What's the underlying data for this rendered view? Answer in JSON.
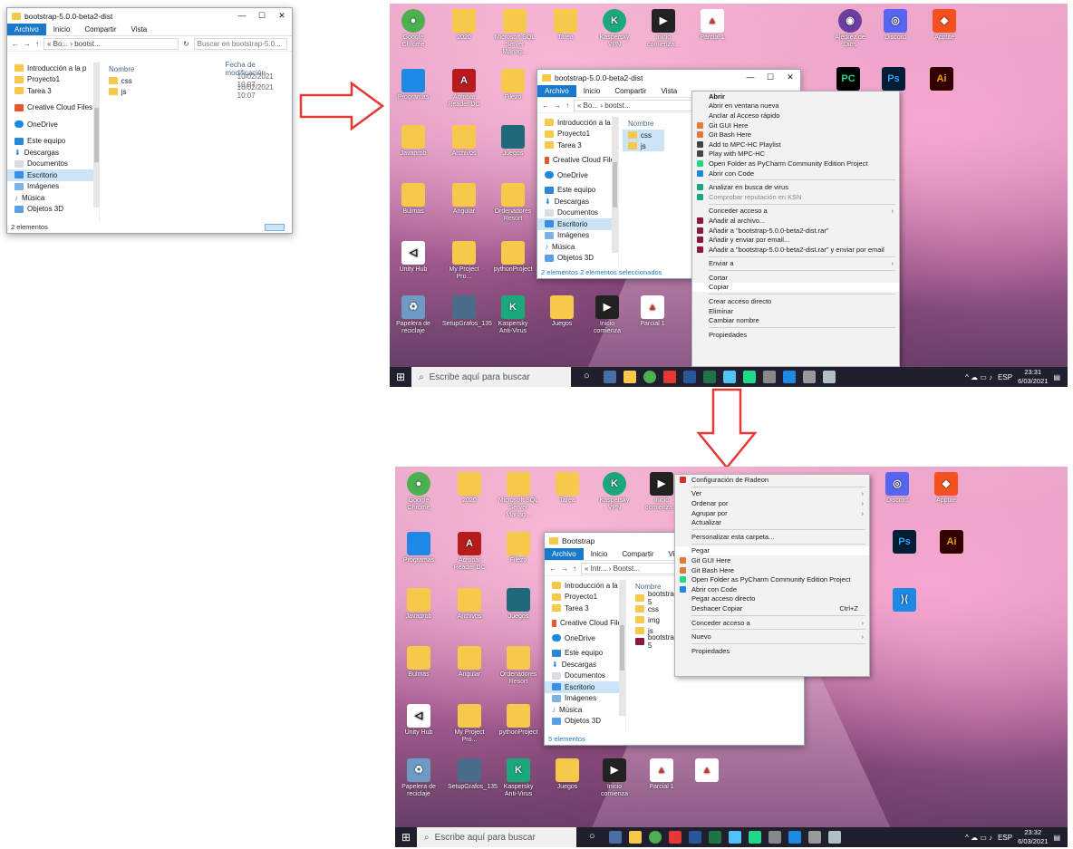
{
  "colors": {
    "accent": "#1979ca",
    "selection": "#cce4f7",
    "folder": "#f6c94a",
    "arrow": "#e53935",
    "taskbar": "#1f1f2e"
  },
  "small_window": {
    "title": "bootstrap-5.0.0-beta2-dist",
    "ribbon_tabs": [
      "Archivo",
      "Inicio",
      "Compartir",
      "Vista"
    ],
    "address": "« Bo... › bootst...",
    "search_placeholder": "Buscar en bootstrap-5.0...",
    "nav_items": [
      "Introducción a la p",
      "Proyecto1",
      "Tarea 3",
      "Creative Cloud Files",
      "OneDrive",
      "Este equipo",
      "Descargas",
      "Documentos",
      "Escritorio",
      "Imágenes",
      "Música",
      "Objetos 3D"
    ],
    "selected_nav": "Escritorio",
    "col_name": "Nombre",
    "col_date": "Fecha de modificación",
    "files": [
      {
        "name": "css",
        "date": "10/02/2021 10:07"
      },
      {
        "name": "js",
        "date": "10/02/2021 10:07"
      }
    ],
    "status": "2 elementos"
  },
  "desktop_icons_top": [
    "Google Chrome",
    "2020",
    "Microsoft SQL Server Manag...",
    "Tarea",
    "Kaspersky VPN",
    "Inicio comienza...",
    "Parcial 1",
    "Ajedrez de Dios",
    "Discord",
    "Apptite"
  ],
  "desktop_icons_left": [
    "Programas",
    "Acrobat Reader DC",
    "Filezo",
    "Javaprob",
    "Archivos",
    "Juegos",
    "Bulmas",
    "Angular",
    "Ordenadores Resort",
    "Unity Hub",
    "My Project Pro...",
    "pythonProject",
    "Papelera de reciclaje",
    "SetupGrafos_135",
    "Kaspersky Anti-Virus",
    "Juegos",
    "Inicio comienza",
    "Parcial 1"
  ],
  "window1": {
    "title": "bootstrap-5.0.0-beta2-dist",
    "ribbon_tabs": [
      "Archivo",
      "Inicio",
      "Compartir",
      "Vista"
    ],
    "address": "« Bo... › bootst...",
    "nav_items": [
      "Introducción a la p",
      "Proyecto1",
      "Tarea 3",
      "Creative Cloud Files",
      "OneDrive",
      "Este equipo",
      "Descargas",
      "Documentos",
      "Escritorio",
      "Imágenes",
      "Música",
      "Objetos 3D"
    ],
    "selected_nav": "Escritorio",
    "col_name": "Nombre",
    "files": [
      "css",
      "js"
    ],
    "status": "2 elementos    2 elementos seleccionados"
  },
  "context_menu1": [
    {
      "label": "Abrir",
      "bold": true
    },
    {
      "label": "Abrir en ventana nueva"
    },
    {
      "label": "Anclar al Acceso rápido"
    },
    {
      "label": "Git GUI Here",
      "icon": "#e07b39"
    },
    {
      "label": "Git Bash Here",
      "icon": "#e07b39"
    },
    {
      "label": "Add to MPC-HC Playlist",
      "icon": "#444"
    },
    {
      "label": "Play with MPC-HC",
      "icon": "#444"
    },
    {
      "label": "Open Folder as PyCharm Community Edition Project",
      "icon": "#21d789"
    },
    {
      "label": "Abrir con Code",
      "icon": "#1e88e5"
    },
    {
      "sep": true
    },
    {
      "label": "Analizar en busca de virus",
      "icon": "#1ba87c"
    },
    {
      "label": "Comprobar reputación en KSN",
      "icon": "#1ba87c",
      "disabled": true
    },
    {
      "sep": true
    },
    {
      "label": "Conceder acceso a",
      "submenu": true
    },
    {
      "label": "Añadir al archivo...",
      "icon": "#8b1a3a"
    },
    {
      "label": "Añadir a \"bootstrap-5.0.0-beta2-dist.rar\"",
      "icon": "#8b1a3a"
    },
    {
      "label": "Añadir y enviar por email...",
      "icon": "#8b1a3a"
    },
    {
      "label": "Añadir a \"bootstrap-5.0.0-beta2-dist.rar\" y enviar por email",
      "icon": "#8b1a3a"
    },
    {
      "sep": true
    },
    {
      "label": "Enviar a",
      "submenu": true
    },
    {
      "sep": true
    },
    {
      "label": "Cortar"
    },
    {
      "label": "Copiar",
      "highlight": true
    },
    {
      "sep": true
    },
    {
      "label": "Crear acceso directo"
    },
    {
      "label": "Eliminar"
    },
    {
      "label": "Cambiar nombre"
    },
    {
      "sep": true
    },
    {
      "label": "Propiedades"
    }
  ],
  "taskbar1": {
    "search": "Escribe aquí para buscar",
    "time": "23:31",
    "date": "6/03/2021",
    "lang": "ESP"
  },
  "window2": {
    "title": "Bootstrap",
    "ribbon_tabs": [
      "Archivo",
      "Inicio",
      "Compartir",
      "Vista"
    ],
    "address": "« Intr... › Bootst...",
    "nav_items": [
      "Introducción a la p",
      "Proyecto1",
      "Tarea 3",
      "Creative Cloud Files",
      "OneDrive",
      "Este equipo",
      "Descargas",
      "Documentos",
      "Escritorio",
      "Imágenes",
      "Música",
      "Objetos 3D"
    ],
    "selected_nav": "Escritorio",
    "col_name": "Nombre",
    "files": [
      "bootstrap-5",
      "css",
      "img",
      "js",
      "bootstrap-5"
    ],
    "status": "5 elementos"
  },
  "context_menu2": [
    {
      "label": "Configuración de Radeon",
      "icon": "#d32f2f"
    },
    {
      "sep": true
    },
    {
      "label": "Ver",
      "submenu": true
    },
    {
      "label": "Ordenar por",
      "submenu": true
    },
    {
      "label": "Agrupar por",
      "submenu": true
    },
    {
      "label": "Actualizar"
    },
    {
      "sep": true
    },
    {
      "label": "Personalizar esta carpeta..."
    },
    {
      "sep": true
    },
    {
      "label": "Pegar",
      "highlight": true
    },
    {
      "label": "Git GUI Here",
      "icon": "#e07b39"
    },
    {
      "label": "Git Bash Here",
      "icon": "#e07b39"
    },
    {
      "label": "Open Folder as PyCharm Community Edition Project",
      "icon": "#21d789"
    },
    {
      "label": "Abrir con Code",
      "icon": "#1e88e5"
    },
    {
      "label": "Pegar acceso directo"
    },
    {
      "label": "Deshacer Copiar",
      "shortcut": "Ctrl+Z"
    },
    {
      "sep": true
    },
    {
      "label": "Conceder acceso a",
      "submenu": true
    },
    {
      "sep": true
    },
    {
      "label": "Nuevo",
      "submenu": true
    },
    {
      "sep": true
    },
    {
      "label": "Propiedades"
    }
  ],
  "taskbar2": {
    "search": "Escribe aquí para buscar",
    "time": "23:32",
    "date": "6/03/2021",
    "lang": "ESP"
  }
}
